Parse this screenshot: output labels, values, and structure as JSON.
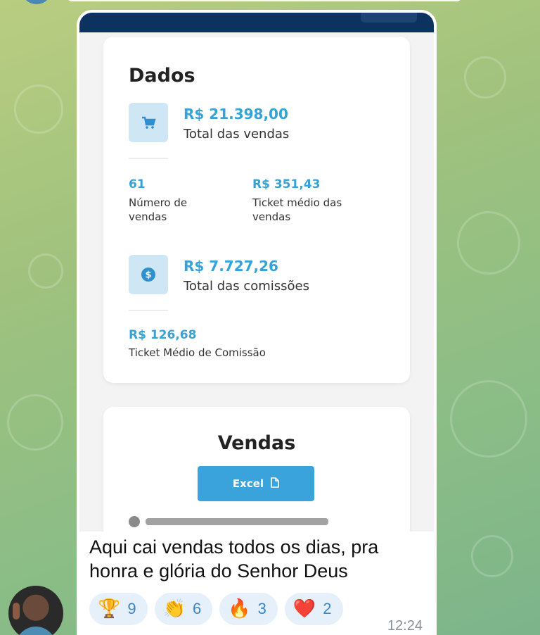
{
  "dados": {
    "title": "Dados",
    "total_vendas_value": "R$ 21.398,00",
    "total_vendas_label": "Total das vendas",
    "numero_vendas_value": "61",
    "numero_vendas_label": "Número de vendas",
    "ticket_medio_value": "R$ 351,43",
    "ticket_medio_label": "Ticket médio das vendas",
    "total_comissoes_value": "R$ 7.727,26",
    "total_comissoes_label": "Total das comissões",
    "ticket_comissao_value": "R$ 126,68",
    "ticket_comissao_label": "Ticket Médio de Comissão",
    "icons": {
      "cart": "cart-icon",
      "dollar": "dollar-coin-icon"
    }
  },
  "vendas": {
    "title": "Vendas",
    "excel_label": "Excel",
    "excel_icon": "document-icon"
  },
  "message": {
    "caption": "Aqui cai vendas todos os dias, pra honra e glória do Senhor Deus",
    "time": "12:24"
  },
  "reactions": [
    {
      "emoji": "🏆",
      "name": "trophy-icon",
      "count": "9"
    },
    {
      "emoji": "👏",
      "name": "clapping-hands-icon",
      "count": "6"
    },
    {
      "emoji": "🔥",
      "name": "fire-icon",
      "count": "3"
    },
    {
      "emoji": "❤️",
      "name": "heart-icon",
      "count": "2"
    }
  ],
  "colors": {
    "accent_blue": "#35a2d8",
    "header_navy": "#0c3360",
    "excel_button": "#3aa3dc",
    "reaction_count": "#3a86c6"
  }
}
